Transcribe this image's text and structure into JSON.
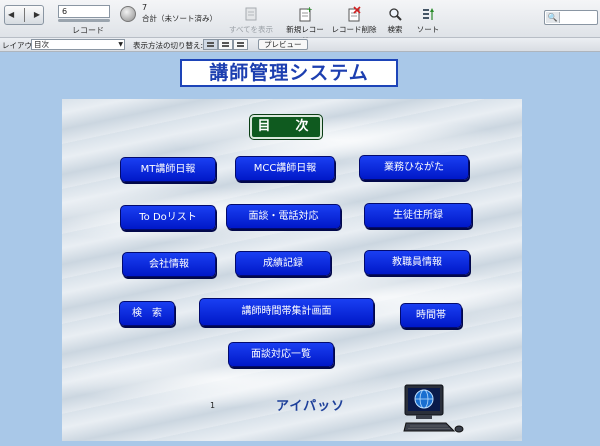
{
  "toolbar": {
    "record_number": "6",
    "record_caption": "レコード",
    "total_count": "7",
    "total_caption": "合計（未ソート済み）",
    "show_all_label": "すべてを表示",
    "new_record_label": "新規レコード",
    "delete_record_label": "レコード削除",
    "search_label": "検索",
    "sort_label": "ソート"
  },
  "layoutbar": {
    "layout_label": "レイアウト:",
    "layout_value": "目次",
    "view_as_label": "表示方法の切り替え:",
    "preview_label": "プレビュー"
  },
  "main": {
    "system_title": "講師管理システム",
    "index_label": "目　次",
    "buttons": [
      "MT講師日報",
      "MCC講師日報",
      "業務ひながた",
      "To Doリスト",
      "面談・電話対応",
      "生徒住所録",
      "会社情報",
      "成績記録",
      "教職員情報",
      "検　索",
      "講師時間帯集計画面",
      "時間帯",
      "面談対応一覧"
    ],
    "page_count": "1",
    "company_name": "アイパッソ"
  },
  "colors": {
    "title_blue": "#1d3fb0",
    "button_blue": "#0a28e0",
    "badge_green": "#0f5a1f",
    "page_bg": "#a9c8e8"
  },
  "icons": [
    "book-icon",
    "pie-icon",
    "show-all-icon",
    "new-record-icon",
    "delete-record-icon",
    "search-icon",
    "sort-icon",
    "computer-globe-icon"
  ]
}
